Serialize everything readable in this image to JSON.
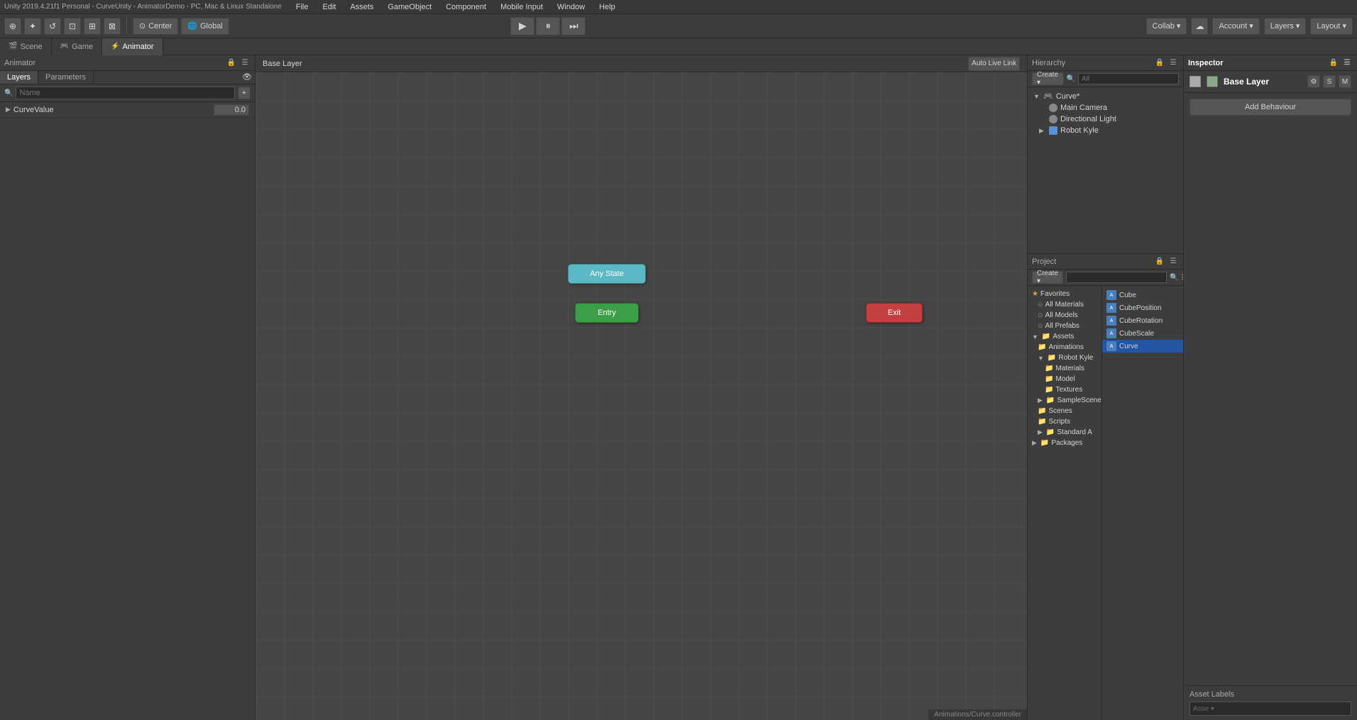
{
  "window": {
    "title": "Unity 2019.4.21f1 Personal - CurveUnity - AnimatorDemo - PC, Mac & Linux Standalone"
  },
  "menubar": {
    "items": [
      "File",
      "Edit",
      "Assets",
      "GameObject",
      "Component",
      "Mobile Input",
      "Window",
      "Help"
    ]
  },
  "toolbar": {
    "transform_tools": [
      "⊕",
      "✦",
      "↺",
      "⊡",
      "⊞",
      "⊠"
    ],
    "pivot_center": "Center",
    "pivot_global": "Global",
    "play": "▶",
    "pause": "⏸",
    "step": "⏭",
    "collab": "Collab ▾",
    "cloud_icon": "☁",
    "account": "Account ▾",
    "layers": "Layers ▾",
    "layout": "Layout ▾"
  },
  "tabs": [
    {
      "id": "scene",
      "label": "Scene",
      "icon": "🎬",
      "active": false
    },
    {
      "id": "game",
      "label": "Game",
      "icon": "🎮",
      "active": false
    },
    {
      "id": "animator",
      "label": "Animator",
      "icon": "⚡",
      "active": true
    }
  ],
  "animator": {
    "panel_header": "Animator",
    "layers_tab": "Layers",
    "params_tab": "Parameters",
    "search_placeholder": "Name",
    "add_btn": "+",
    "eye_icon": "👁",
    "base_layer": "Base Layer",
    "auto_live_link": "Auto Live Link",
    "params": [
      {
        "name": "CurveValue",
        "value": "0.0"
      }
    ],
    "states": {
      "any": "Any State",
      "entry": "Entry",
      "exit": "Exit"
    },
    "footer_path": "Animations/Curve.controller"
  },
  "hierarchy": {
    "title": "Hierarchy",
    "create_btn": "Create ▾",
    "search_placeholder": "All",
    "scene_name": "Curve*",
    "items": [
      {
        "name": "Main Camera",
        "indent": 1,
        "icon": "📷",
        "expand": false
      },
      {
        "name": "Directional Light",
        "indent": 1,
        "icon": "💡",
        "expand": false
      },
      {
        "name": "Robot Kyle",
        "indent": 1,
        "icon": "🤖",
        "expand": true
      }
    ]
  },
  "project": {
    "title": "Project",
    "create_btn": "Create ▾",
    "tree": [
      {
        "id": "favorites",
        "label": "Favorites",
        "icon": "star",
        "expanded": true
      },
      {
        "id": "all-materials",
        "label": "All Materials",
        "icon": "search",
        "indent": 1
      },
      {
        "id": "all-models",
        "label": "All Models",
        "icon": "search",
        "indent": 1
      },
      {
        "id": "all-prefabs",
        "label": "All Prefabs",
        "icon": "search",
        "indent": 1
      },
      {
        "id": "assets",
        "label": "Assets",
        "icon": "folder",
        "expanded": true
      },
      {
        "id": "animations",
        "label": "Animations",
        "icon": "folder",
        "indent": 1
      },
      {
        "id": "robot-kyle",
        "label": "Robot Kyle",
        "icon": "folder",
        "indent": 1,
        "expanded": true
      },
      {
        "id": "materials",
        "label": "Materials",
        "icon": "folder",
        "indent": 2
      },
      {
        "id": "model",
        "label": "Model",
        "icon": "folder",
        "indent": 2
      },
      {
        "id": "textures",
        "label": "Textures",
        "icon": "folder",
        "indent": 2
      },
      {
        "id": "samplescene",
        "label": "SampleScene",
        "icon": "folder",
        "indent": 1,
        "collapsed": true
      },
      {
        "id": "scenes",
        "label": "Scenes",
        "icon": "folder",
        "indent": 1
      },
      {
        "id": "scripts",
        "label": "Scripts",
        "icon": "folder",
        "indent": 1
      },
      {
        "id": "standard-a",
        "label": "Standard A",
        "icon": "folder",
        "indent": 1,
        "collapsed": true
      },
      {
        "id": "packages",
        "label": "Packages",
        "icon": "folder"
      }
    ],
    "files": [
      {
        "name": "Cube",
        "type": "anim"
      },
      {
        "name": "CubePosition",
        "type": "anim"
      },
      {
        "name": "CubeRotation",
        "type": "anim"
      },
      {
        "name": "CubeScale",
        "type": "anim"
      },
      {
        "name": "Curve",
        "type": "anim",
        "selected": true
      }
    ]
  },
  "inspector": {
    "title": "Inspector",
    "layer_name": "Base Layer",
    "add_behaviour_label": "Add Behaviour",
    "asset_labels_title": "Asset Labels",
    "asset_labels_btn": "Asse ▾"
  }
}
